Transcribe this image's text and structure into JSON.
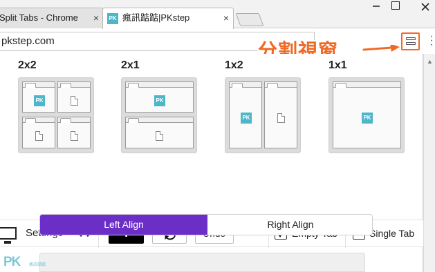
{
  "browser": {
    "tabs": [
      {
        "title": "Split Tabs - Chrome 線上",
        "active": false
      },
      {
        "title": "瘋訊踮踮|PKstep",
        "active": true,
        "favicon": "PK"
      }
    ],
    "address": "pkstep.com",
    "tab_close_glyph": "×"
  },
  "annotation": {
    "callout_text": "分割視窗",
    "accent_color": "#ef6a26"
  },
  "popup": {
    "layouts": [
      {
        "label": "2x2"
      },
      {
        "label": "2x1"
      },
      {
        "label": "1x2"
      },
      {
        "label": "1x1"
      }
    ],
    "pk_badge": "PK",
    "controls": {
      "settings_label": "Settings",
      "plus_label": "+",
      "undo_label": "Undo",
      "empty_tab_label": "Empty Tab",
      "empty_tab_checked": true,
      "single_tab_label": "Single Tab",
      "single_tab_checked": false
    },
    "align": {
      "left_label": "Left Align",
      "right_label": "Right Align",
      "selected": "left",
      "selected_color": "#6b2fc8"
    }
  },
  "watermark": {
    "text": "PK",
    "subtext": "瘋訊踮踮"
  }
}
